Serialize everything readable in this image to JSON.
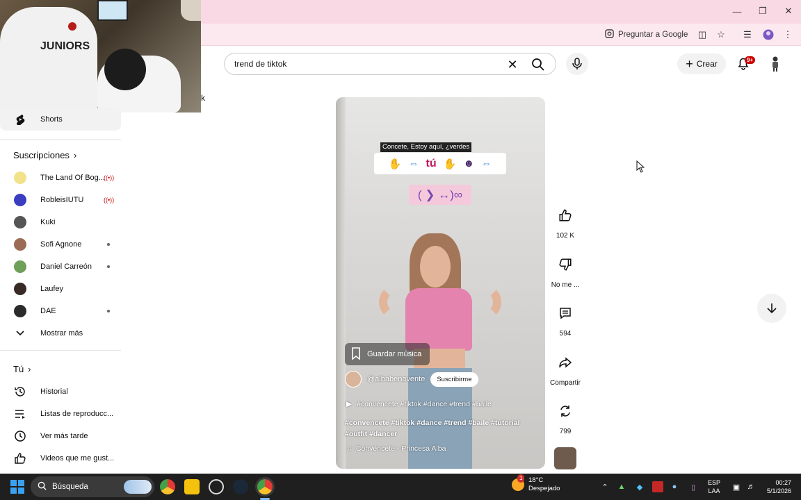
{
  "browser": {
    "ask_google": "Preguntar a Google",
    "window_controls": [
      "minimize",
      "maximize",
      "close"
    ]
  },
  "header": {
    "search_value": "trend de tiktok",
    "create_label": "Crear",
    "notifications_badge": "9+"
  },
  "overlay": {
    "stray_text": "k",
    "webcam_shirt_text": "JUNIORS"
  },
  "sidebar": {
    "shorts_label": "Shorts",
    "subscriptions_heading": "Suscripciones",
    "subscriptions": [
      {
        "name": "The Land Of Bog...",
        "live": true,
        "avatar_color": "#f2e28c"
      },
      {
        "name": "RobleisIUTU",
        "live": true,
        "avatar_color": "#3b3fbf"
      },
      {
        "name": "Kuki",
        "live": false,
        "dot": false,
        "avatar_color": "#555555"
      },
      {
        "name": "Sofi Agnone",
        "live": false,
        "dot": true,
        "avatar_color": "#9a6b55"
      },
      {
        "name": "Daniel Carreón",
        "live": false,
        "dot": true,
        "avatar_color": "#6fa05a"
      },
      {
        "name": "Laufey",
        "live": false,
        "dot": false,
        "avatar_color": "#3a2a25"
      },
      {
        "name": "DAE",
        "live": false,
        "dot": true,
        "avatar_color": "#2b2b2b"
      }
    ],
    "show_more": "Mostrar más",
    "you_heading": "Tú",
    "you_items": [
      "Historial",
      "Listas de reproducc...",
      "Ver más tarde",
      "Videos que me gust..."
    ]
  },
  "short": {
    "caption_text": "Concete, Estoy aquí, ¿verdes",
    "sticker_word": "tú",
    "sticker2": "( ❯ ↔)∞",
    "save_music": "Guardar música",
    "channel": "@albabenavente",
    "subscribe": "Suscribirme",
    "playlist": "#convencete #tiktok #dance #trend #baile",
    "description": "#convencete #tiktok #dance #trend #baile #tutorial #outfit #dancer",
    "sound": "Convéncete - Princesa Alba"
  },
  "actions": {
    "like_count": "102 K",
    "dislike_label": "No me ...",
    "comments_count": "594",
    "share_label": "Compartir",
    "remix_count": "799"
  },
  "taskbar": {
    "search_label": "Búsqueda",
    "weather_temp": "18°C",
    "weather_desc": "Despejado",
    "weather_badge": "1",
    "lang_line1": "ESP",
    "lang_line2": "LAA",
    "time": "00:27",
    "date": "5/1/2026"
  },
  "colors": {
    "titlebar": "#f9d9e4",
    "accent_red": "#cc0000",
    "taskbar": "#1f1f1f"
  }
}
